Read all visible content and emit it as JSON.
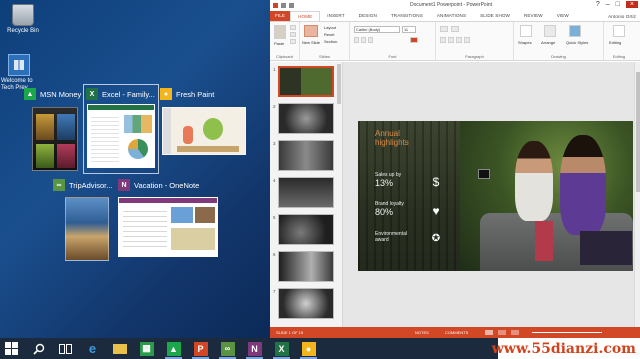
{
  "desktop": {
    "icons": [
      {
        "label": "Recycle Bin",
        "icon": "recycle-bin-icon"
      },
      {
        "label": "Welcome to Tech Prev...",
        "icon": "windows-welcome-icon"
      }
    ]
  },
  "task_view": {
    "windows": [
      {
        "title": "MSN Money",
        "icon": "msn-money-icon",
        "color": "#1ba74a"
      },
      {
        "title": "Excel - Family...",
        "icon": "excel-icon",
        "color": "#217346"
      },
      {
        "title": "Fresh Paint",
        "icon": "fresh-paint-icon",
        "color": "#f3b51b"
      },
      {
        "title": "TripAdvisor...",
        "icon": "tripadvisor-icon",
        "color": "#589442"
      },
      {
        "title": "Vacation - OneNote",
        "icon": "onenote-icon",
        "color": "#80397b"
      }
    ]
  },
  "powerpoint": {
    "window_title": "Document1 Powerpoint - PowerPoint",
    "user": "Antonio Ortiz",
    "tabs": [
      "FILE",
      "HOME",
      "INSERT",
      "DESIGN",
      "TRANSITIONS",
      "ANIMATIONS",
      "SLIDE SHOW",
      "REVIEW",
      "VIEW"
    ],
    "active_tab": "HOME",
    "ribbon": {
      "groups": [
        "Clipboard",
        "Slides",
        "Font",
        "Paragraph",
        "Drawing",
        "Editing"
      ],
      "paste_label": "Paste",
      "new_slide_label": "New Slide",
      "font_name": "Calibri (Body)",
      "font_size": "11",
      "shapes_label": "Shapes",
      "arrange_label": "Arrange",
      "quick_styles_label": "Quick Styles",
      "editing_label": "Editing",
      "layout_label": "Layout",
      "reset_label": "Reset",
      "section_label": "Section"
    },
    "slide_numbers": [
      "1",
      "2",
      "3",
      "4",
      "5",
      "6",
      "7"
    ],
    "slide": {
      "title": "Annual\nhighlights",
      "stats": [
        {
          "label": "Sales up by",
          "value": "13%",
          "icon": "dollar-icon"
        },
        {
          "label": "Brand loyalty",
          "value": "80%",
          "icon": "heart-icon"
        },
        {
          "label": "Environmental",
          "value": "award",
          "icon": "award-icon"
        }
      ]
    },
    "status": {
      "slide_info": "SLIDE 1 OF 15",
      "notes": "NOTES",
      "comments": "COMMENTS"
    },
    "accent": "#d24726"
  },
  "taskbar": {
    "items": [
      {
        "name": "start",
        "icon": "windows-start-icon",
        "running": false
      },
      {
        "name": "search",
        "icon": "search-icon",
        "running": false
      },
      {
        "name": "task view",
        "icon": "task-view-icon",
        "running": false
      },
      {
        "name": "internet explorer",
        "icon": "internet-explorer-icon",
        "running": false
      },
      {
        "name": "file explorer",
        "icon": "file-explorer-icon",
        "running": false
      },
      {
        "name": "store",
        "icon": "store-icon",
        "running": false
      },
      {
        "name": "msn money",
        "icon": "msn-money-icon",
        "running": true
      },
      {
        "name": "powerpoint",
        "icon": "powerpoint-icon",
        "running": true
      },
      {
        "name": "tripadvisor",
        "icon": "tripadvisor-icon",
        "running": true
      },
      {
        "name": "onenote",
        "icon": "onenote-icon",
        "running": true
      },
      {
        "name": "excel",
        "icon": "excel-icon",
        "running": true
      },
      {
        "name": "fresh paint",
        "icon": "fresh-paint-icon",
        "running": true
      }
    ]
  },
  "watermark": "www.55dianzi.com"
}
